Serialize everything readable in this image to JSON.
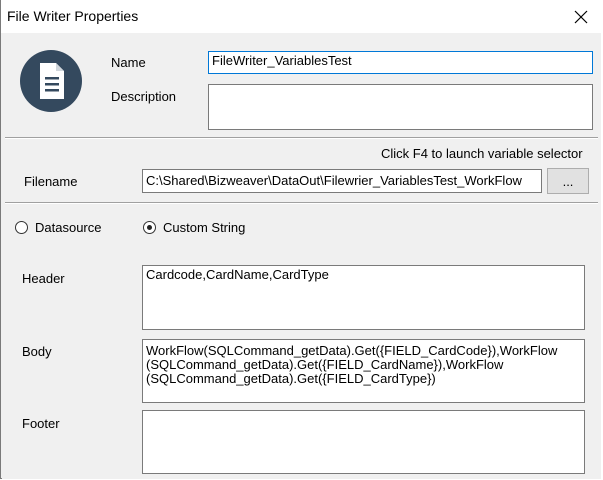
{
  "window": {
    "title": "File Writer Properties",
    "close_icon": "close-icon"
  },
  "general": {
    "icon": "document-icon",
    "name_label": "Name",
    "name_value": "FileWriter_VariablesTest",
    "description_label": "Description",
    "description_value": ""
  },
  "file": {
    "hint": "Click F4 to launch variable selector",
    "filename_label": "Filename",
    "filename_value": "C:\\Shared\\Bizweaver\\DataOut\\Filewrier_VariablesTest_WorkFlow",
    "browse_label": "..."
  },
  "source": {
    "options": [
      {
        "label": "Datasource",
        "checked": false
      },
      {
        "label": "Custom String",
        "checked": true
      }
    ]
  },
  "content": {
    "header_label": "Header",
    "header_value": "Cardcode,CardName,CardType",
    "body_label": "Body",
    "body_value": "WorkFlow(SQLCommand_getData).Get({FIELD_CardCode}),WorkFlow\n(SQLCommand_getData).Get({FIELD_CardName}),WorkFlow\n(SQLCommand_getData).Get({FIELD_CardType})",
    "footer_label": "Footer",
    "footer_value": ""
  },
  "colors": {
    "focus_border": "#0078d7",
    "dialog_bg": "#f0f0f0",
    "icon_fill": "#34495e"
  }
}
